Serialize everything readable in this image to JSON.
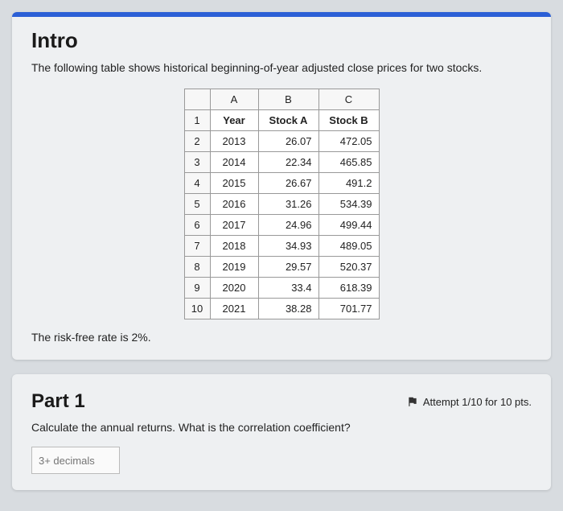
{
  "intro": {
    "title": "Intro",
    "description": "The following table shows historical beginning-of-year adjusted close prices for two stocks.",
    "footnote": "The risk-free rate is 2%."
  },
  "table": {
    "colLabels": {
      "a": "A",
      "b": "B",
      "c": "C"
    },
    "headers": {
      "year": "Year",
      "stockA": "Stock A",
      "stockB": "Stock B"
    },
    "rows": [
      {
        "n": "1",
        "year": "Year",
        "a": "Stock A",
        "b": "Stock B",
        "isHeader": true
      },
      {
        "n": "2",
        "year": "2013",
        "a": "26.07",
        "b": "472.05"
      },
      {
        "n": "3",
        "year": "2014",
        "a": "22.34",
        "b": "465.85"
      },
      {
        "n": "4",
        "year": "2015",
        "a": "26.67",
        "b": "491.2"
      },
      {
        "n": "5",
        "year": "2016",
        "a": "31.26",
        "b": "534.39"
      },
      {
        "n": "6",
        "year": "2017",
        "a": "24.96",
        "b": "499.44"
      },
      {
        "n": "7",
        "year": "2018",
        "a": "34.93",
        "b": "489.05"
      },
      {
        "n": "8",
        "year": "2019",
        "a": "29.57",
        "b": "520.37"
      },
      {
        "n": "9",
        "year": "2020",
        "a": "33.4",
        "b": "618.39"
      },
      {
        "n": "10",
        "year": "2021",
        "a": "38.28",
        "b": "701.77"
      }
    ]
  },
  "part1": {
    "title": "Part 1",
    "attempt": "Attempt 1/10 for 10 pts.",
    "prompt": "Calculate the annual returns. What is the correlation coefficient?",
    "placeholder": "3+ decimals"
  },
  "chart_data": {
    "type": "table",
    "title": "Historical beginning-of-year adjusted close prices",
    "columns": [
      "Year",
      "Stock A",
      "Stock B"
    ],
    "rows": [
      [
        2013,
        26.07,
        472.05
      ],
      [
        2014,
        22.34,
        465.85
      ],
      [
        2015,
        26.67,
        491.2
      ],
      [
        2016,
        31.26,
        534.39
      ],
      [
        2017,
        24.96,
        499.44
      ],
      [
        2018,
        34.93,
        489.05
      ],
      [
        2019,
        29.57,
        520.37
      ],
      [
        2020,
        33.4,
        618.39
      ],
      [
        2021,
        38.28,
        701.77
      ]
    ]
  }
}
